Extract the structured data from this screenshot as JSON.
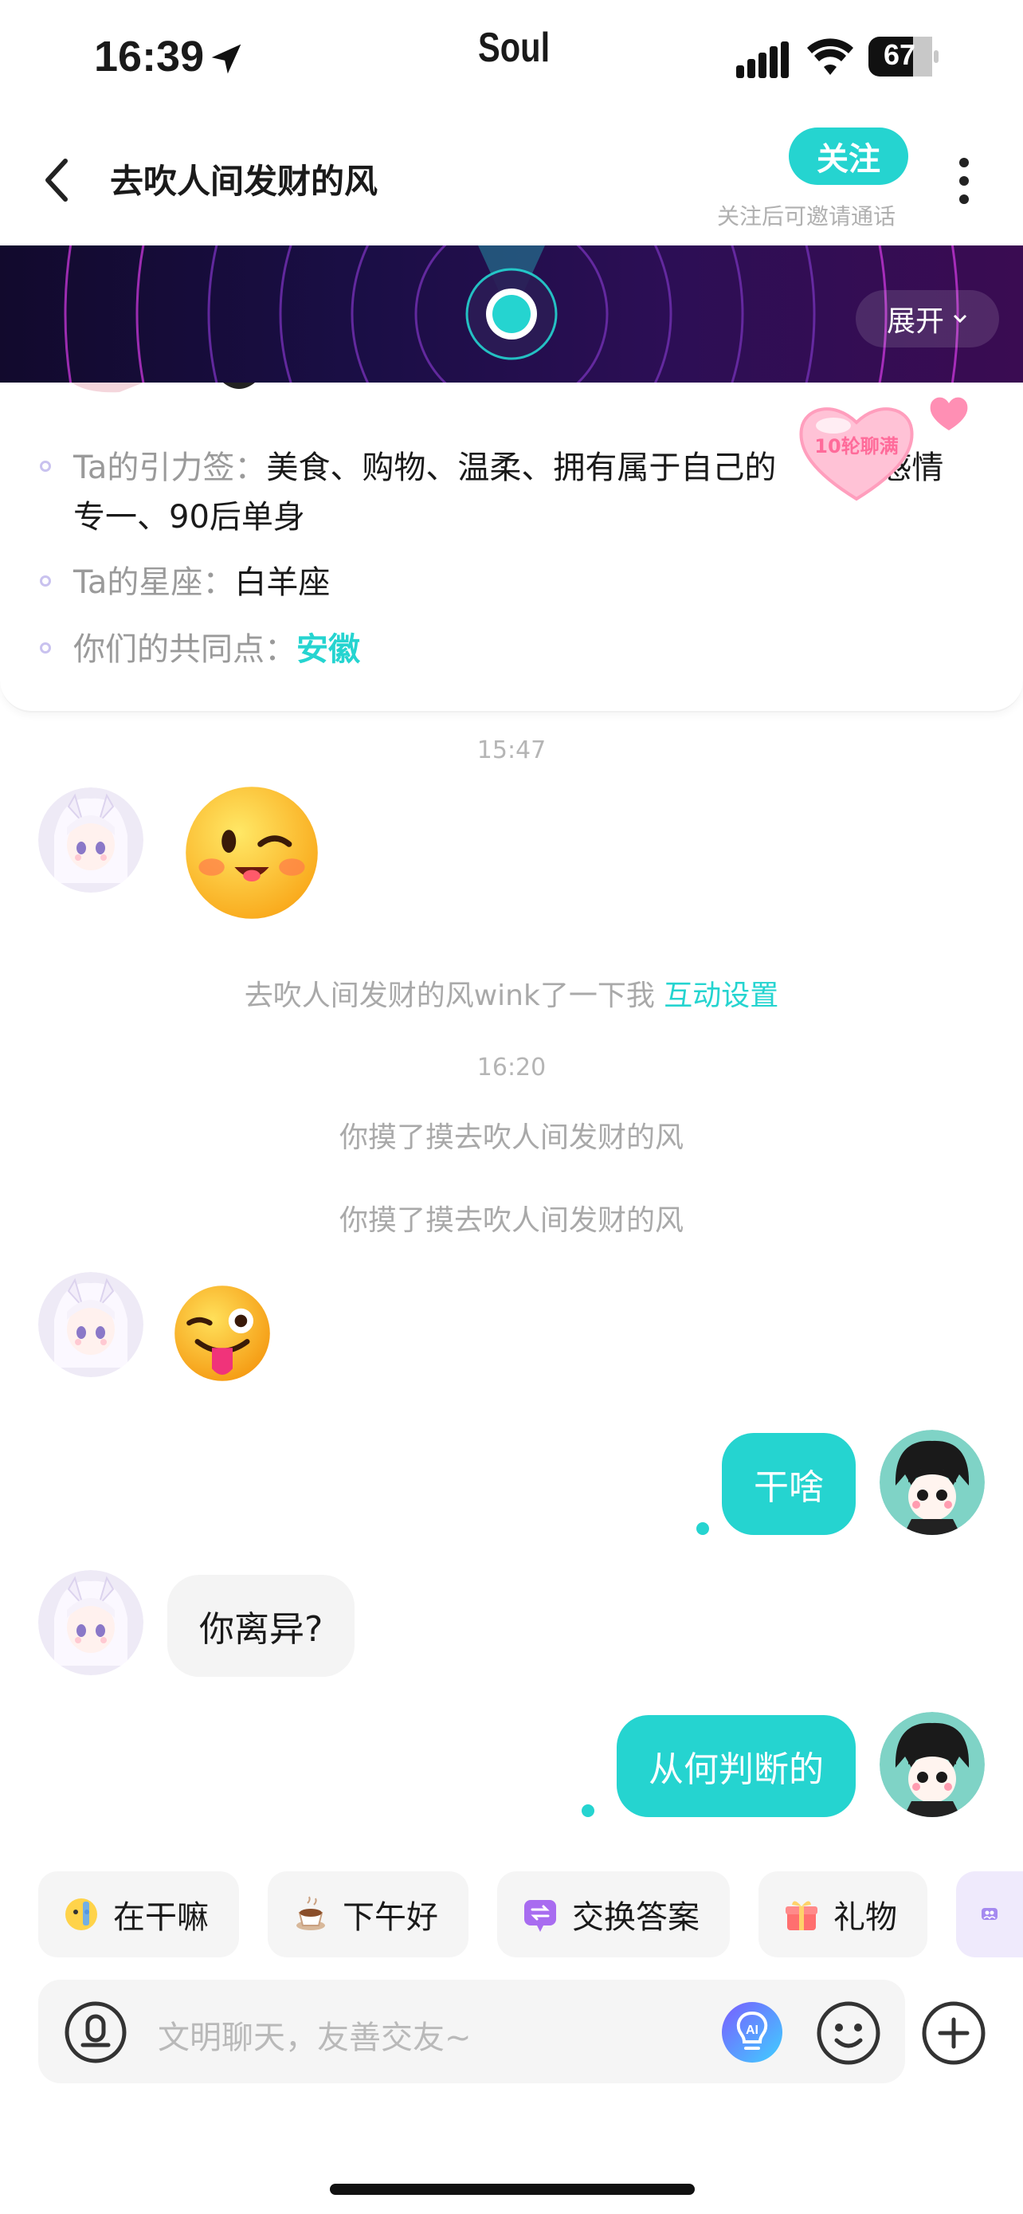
{
  "status_bar": {
    "time": "16:39",
    "app_name": "Soul",
    "battery": "67"
  },
  "header": {
    "title": "去吹人间发财的风",
    "follow_label": "关注",
    "follow_hint": "关注后可邀请通话",
    "back_icon": "chevron-left-icon",
    "more_icon": "more-vertical-icon"
  },
  "banner": {
    "expand_label": "展开"
  },
  "badge": {
    "label": "10轮聊满"
  },
  "info": {
    "tags_label": "Ta的引力签：",
    "tags_value": "美食、购物、温柔、拥有属于自己的",
    "tags_value_2": "感情",
    "tags_value_3": "专一、90后单身",
    "zodiac_label": "Ta的星座：",
    "zodiac_value": "白羊座",
    "common_label": "你们的共同点：",
    "common_value": "安徽"
  },
  "messages": {
    "ts1": "15:47",
    "wink_notice": "去吹人间发财的风wink了一下我",
    "wink_link": "互动设置",
    "ts2": "16:20",
    "pat1": "你摸了摸去吹人间发财的风",
    "pat2": "你摸了摸去吹人间发财的风",
    "out1": "干啥",
    "in1": "你离异?",
    "out2": "从何判断的"
  },
  "quick_replies": [
    {
      "label": "在干嘛",
      "icon": "thinking-emoji-icon"
    },
    {
      "label": "下午好",
      "icon": "coffee-icon"
    },
    {
      "label": "交换答案",
      "icon": "exchange-icon"
    },
    {
      "label": "礼物",
      "icon": "gift-icon"
    }
  ],
  "input": {
    "placeholder": "文明聊天，友善交友~"
  },
  "colors": {
    "accent": "#25d4d0",
    "banner_bg": "#1a0e45"
  }
}
